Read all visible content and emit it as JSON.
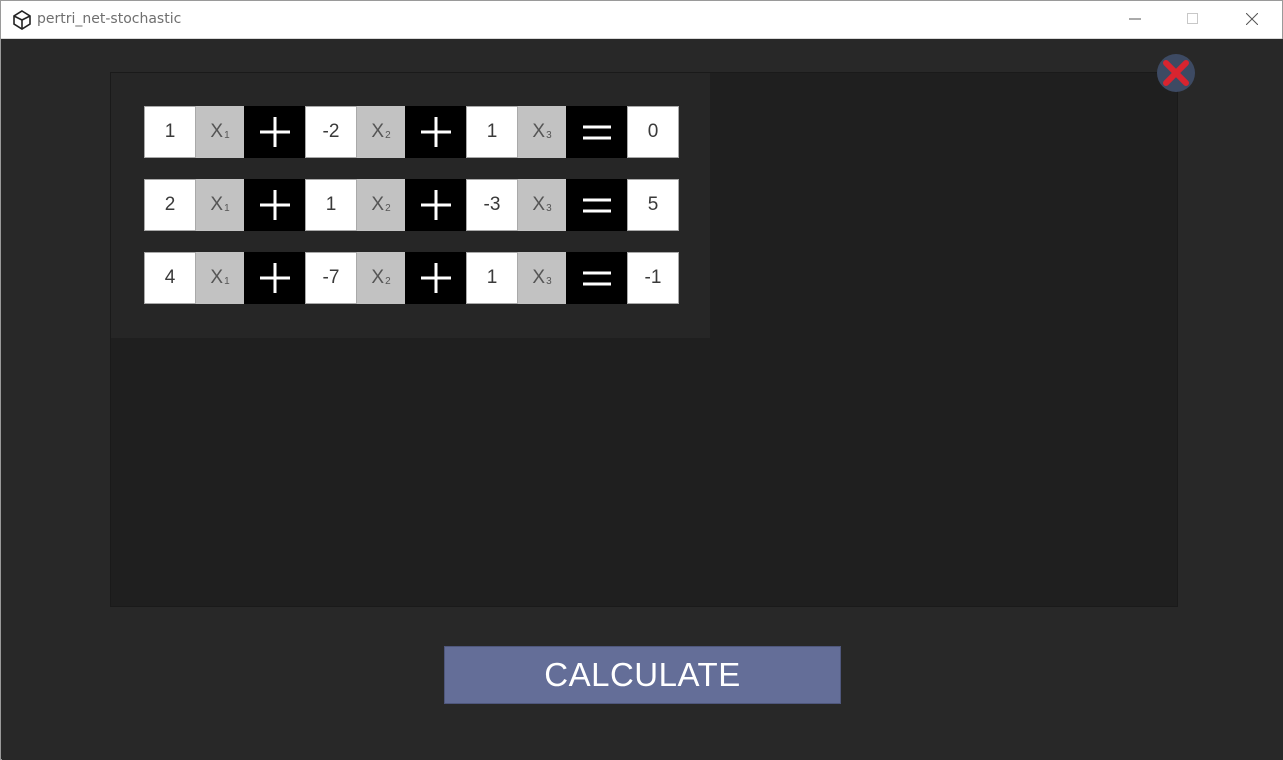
{
  "window": {
    "title": "pertri_net-stochastic"
  },
  "equations": [
    {
      "a": "1",
      "b": "-2",
      "c": "1",
      "r": "0"
    },
    {
      "a": "2",
      "b": "1",
      "c": "-3",
      "r": "5"
    },
    {
      "a": "4",
      "b": "-7",
      "c": "1",
      "r": "-1"
    }
  ],
  "variables": {
    "x1": "X",
    "x2": "X",
    "x3": "X",
    "s1": "1",
    "s2": "2",
    "s3": "3"
  },
  "calculate_label": "CALCULATE",
  "colors": {
    "background": "#282828",
    "panel": "#1f1f1f",
    "button": "#646e98",
    "close_red": "#d9242f",
    "close_circle": "#3d4a63"
  }
}
